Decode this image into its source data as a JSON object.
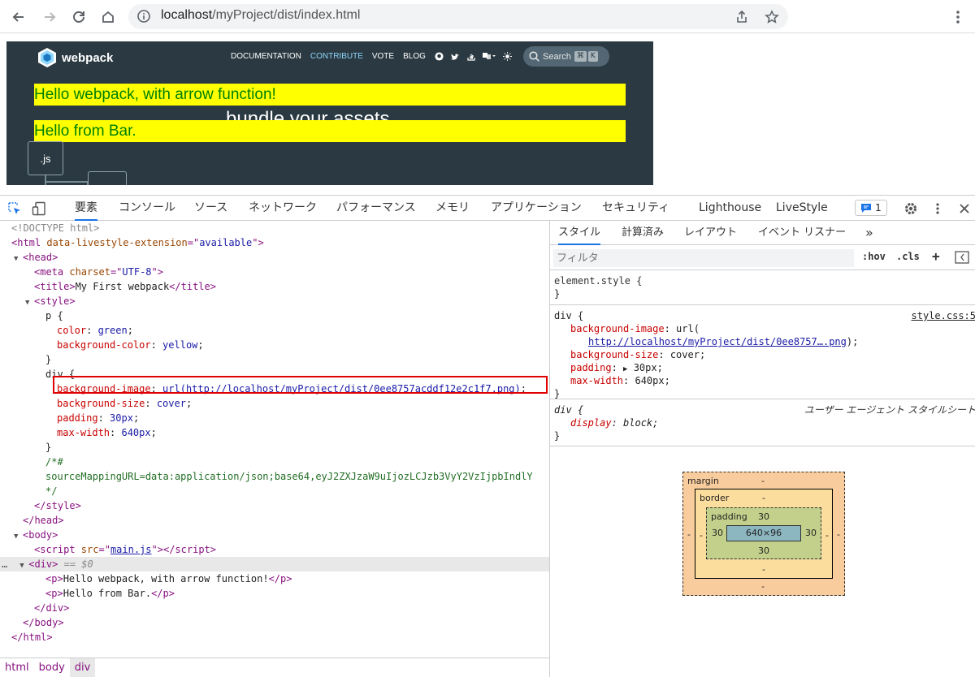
{
  "browser": {
    "url_host": "localhost",
    "url_path": "/myProject/dist/index.html"
  },
  "site": {
    "logo_text": "webpack",
    "nav_links": [
      "DOCUMENTATION",
      "CONTRIBUTE",
      "VOTE",
      "BLOG"
    ],
    "active_link": "CONTRIBUTE",
    "search_placeholder": "Search",
    "search_keys": [
      "⌘",
      "K"
    ],
    "hero_text": "bundle your assets",
    "file_label": ".js",
    "paragraphs": [
      "Hello webpack, with arrow function!",
      "Hello from Bar."
    ],
    "colors": {
      "bg": "#2b3a42",
      "p_bg": "#ffff00",
      "p_fg": "#008000"
    }
  },
  "devtools": {
    "tabs": [
      "要素",
      "コンソール",
      "ソース",
      "ネットワーク",
      "パフォーマンス",
      "メモリ",
      "アプリケーション",
      "セキュリティ",
      "Lighthouse",
      "LiveStyle"
    ],
    "active_tab": "要素",
    "message_count": "1",
    "elements": {
      "doctype": "<!DOCTYPE html>",
      "html_attr_name": "data-livestyle-extension",
      "html_attr_value": "available",
      "meta_charset": "UTF-8",
      "title_text": "My First webpack",
      "css_p_selector": "p {",
      "css_p_color_prop": "color",
      "css_p_color_val": "green",
      "css_p_bg_prop": "background-color",
      "css_p_bg_val": "yellow",
      "css_div_selector": "div {",
      "css_bgimg_prop": "background-image",
      "css_bgimg_url": "http://localhost/myProject/dist/0ee8757acddf12e2c1f7.png",
      "css_bgsize_prop": "background-size",
      "css_bgsize_val": "cover",
      "css_padding_prop": "padding",
      "css_padding_val": "30px",
      "css_maxw_prop": "max-width",
      "css_maxw_val": "640px",
      "source_map_open": "/*#",
      "source_map": "sourceMappingURL=data:application/json;base64,eyJ2ZXJzaW9uIjozLCJzb3VyY2VzIjpbIndlY",
      "source_map_close": "*/",
      "script_src": "main.js",
      "selected_marker": "== $0",
      "p1_text": "Hello webpack, with arrow function!",
      "p2_text": "Hello from Bar."
    },
    "breadcrumbs": [
      "html",
      "body",
      "div"
    ],
    "active_crumb": "div",
    "styles": {
      "sub_tabs": [
        "スタイル",
        "計算済み",
        "レイアウト",
        "イベント リスナー"
      ],
      "active_sub_tab": "スタイル",
      "filter_placeholder": "フィルタ",
      "hov": ":hov",
      "cls": ".cls",
      "element_style": "element.style {",
      "div_rule_source": "style.css:5",
      "bgimg_url_short": "http://localhost/myProject/dist/0ee8757….png",
      "ua_label": "ユーザー エージェント スタイルシート",
      "ua_prop": "display",
      "ua_val": "block"
    },
    "box_model": {
      "margin_label": "margin",
      "border_label": "border",
      "padding_label": "padding",
      "margin": "-",
      "border": "-",
      "padding": "30",
      "content": "640×96"
    }
  }
}
